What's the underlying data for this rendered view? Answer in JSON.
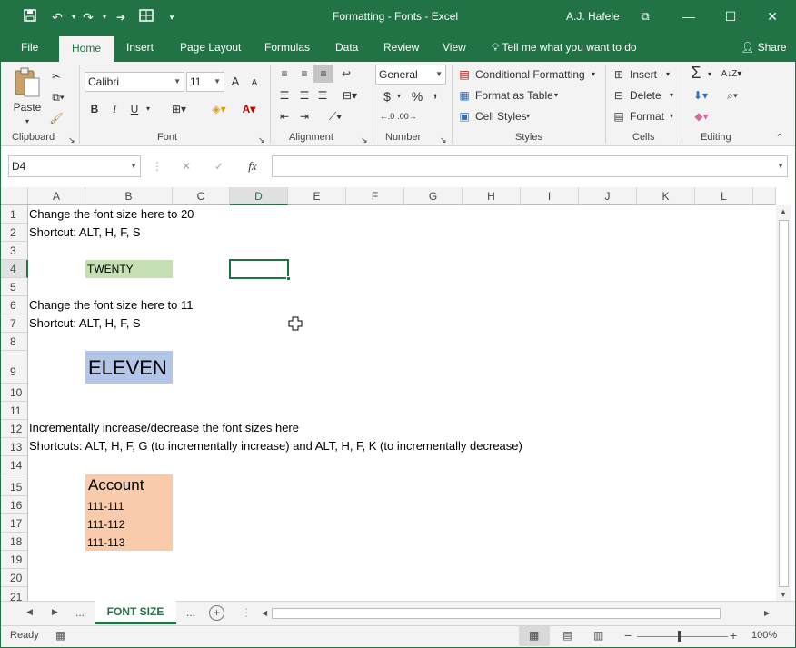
{
  "window": {
    "title": "Formatting - Fonts  -  Excel",
    "user": "A.J. Hafele",
    "minimize": "—",
    "maximize": "☐",
    "close": "✕",
    "restore": "⧉"
  },
  "quick_access": [
    "save-icon",
    "undo-icon",
    "redo-icon",
    "grid-icon",
    "customize-icon"
  ],
  "tabs": [
    "File",
    "Home",
    "Insert",
    "Page Layout",
    "Formulas",
    "Data",
    "Review",
    "View"
  ],
  "tell_me": "Tell me what you want to do",
  "share": "Share",
  "ribbon": {
    "clipboard": {
      "label": "Clipboard",
      "paste": "Paste"
    },
    "font": {
      "label": "Font",
      "name": "Calibri",
      "size": "11",
      "bold": "B",
      "italic": "I",
      "underline": "U",
      "grow": "A",
      "shrink": "A"
    },
    "alignment": {
      "label": "Alignment"
    },
    "number": {
      "label": "Number",
      "format": "General",
      "currency": "$",
      "percent": "%",
      "comma": ","
    },
    "styles": {
      "label": "Styles",
      "conditional": "Conditional Formatting",
      "table": "Format as Table",
      "cell": "Cell Styles"
    },
    "cells": {
      "label": "Cells",
      "insert": "Insert",
      "delete": "Delete",
      "format": "Format"
    },
    "editing": {
      "label": "Editing",
      "sum": "Σ"
    }
  },
  "formula_bar": {
    "name_box": "D4",
    "cancel": "✕",
    "enter": "✓",
    "fx": "fx",
    "value": ""
  },
  "columns": [
    "A",
    "B",
    "C",
    "D",
    "E",
    "F",
    "G",
    "H",
    "I",
    "J",
    "K",
    "L"
  ],
  "rows": [
    "1",
    "2",
    "3",
    "4",
    "5",
    "6",
    "7",
    "8",
    "9",
    "10",
    "11",
    "12",
    "13",
    "14",
    "15",
    "16",
    "17",
    "18",
    "19",
    "20",
    "21"
  ],
  "cells": {
    "a1": "Change the font size here to 20",
    "a2": "Shortcut: ALT, H, F, S",
    "b4": "TWENTY",
    "a6": "Change the font size here to 11",
    "a7": "Shortcut: ALT, H, F, S",
    "b9": "ELEVEN",
    "a12": "Incrementally increase/decrease the font sizes here",
    "a13": "Shortcuts: ALT, H, F, G (to incrementally increase) and ALT, H, F, K (to incrementally decrease)",
    "b15": "Account",
    "b16": "111-111",
    "b17": "111-112",
    "b18": "111-113"
  },
  "colors": {
    "accent": "#217346",
    "green_fill": "#c6e0b4",
    "blue_fill": "#b4c6e7",
    "orange_fill": "#f8cbad"
  },
  "sheet": {
    "prev_more": "...",
    "active": "FONT SIZE",
    "next_more": "...",
    "add": "+"
  },
  "status": {
    "ready": "Ready",
    "zoom": "100%",
    "minus": "−",
    "plus": "+"
  }
}
